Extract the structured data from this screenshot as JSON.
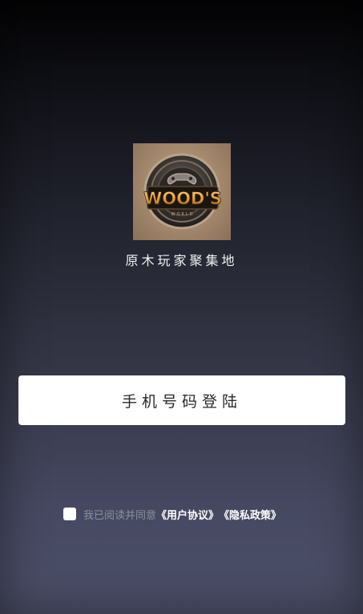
{
  "app": {
    "name": "原木玩家聚集地",
    "logo": {
      "icon": "woods-world-logo-icon",
      "title": "WOOD'S",
      "subtitle": "WORLD",
      "colors": {
        "background": "#a98d70",
        "ring": "#3a3632",
        "gold": "#e8a23a"
      }
    }
  },
  "login": {
    "button_label": "手机号码登陆"
  },
  "agreement": {
    "checkbox_checked": false,
    "prefix": "我已阅读并同意",
    "user_agreement": "《用户协议》",
    "privacy_policy": "《隐私政策》"
  },
  "colors": {
    "background_top": "#030304",
    "background_bottom": "#4d5069",
    "button_bg": "#ffffff",
    "link": "#ffffff",
    "muted_text": "#8e909e"
  }
}
